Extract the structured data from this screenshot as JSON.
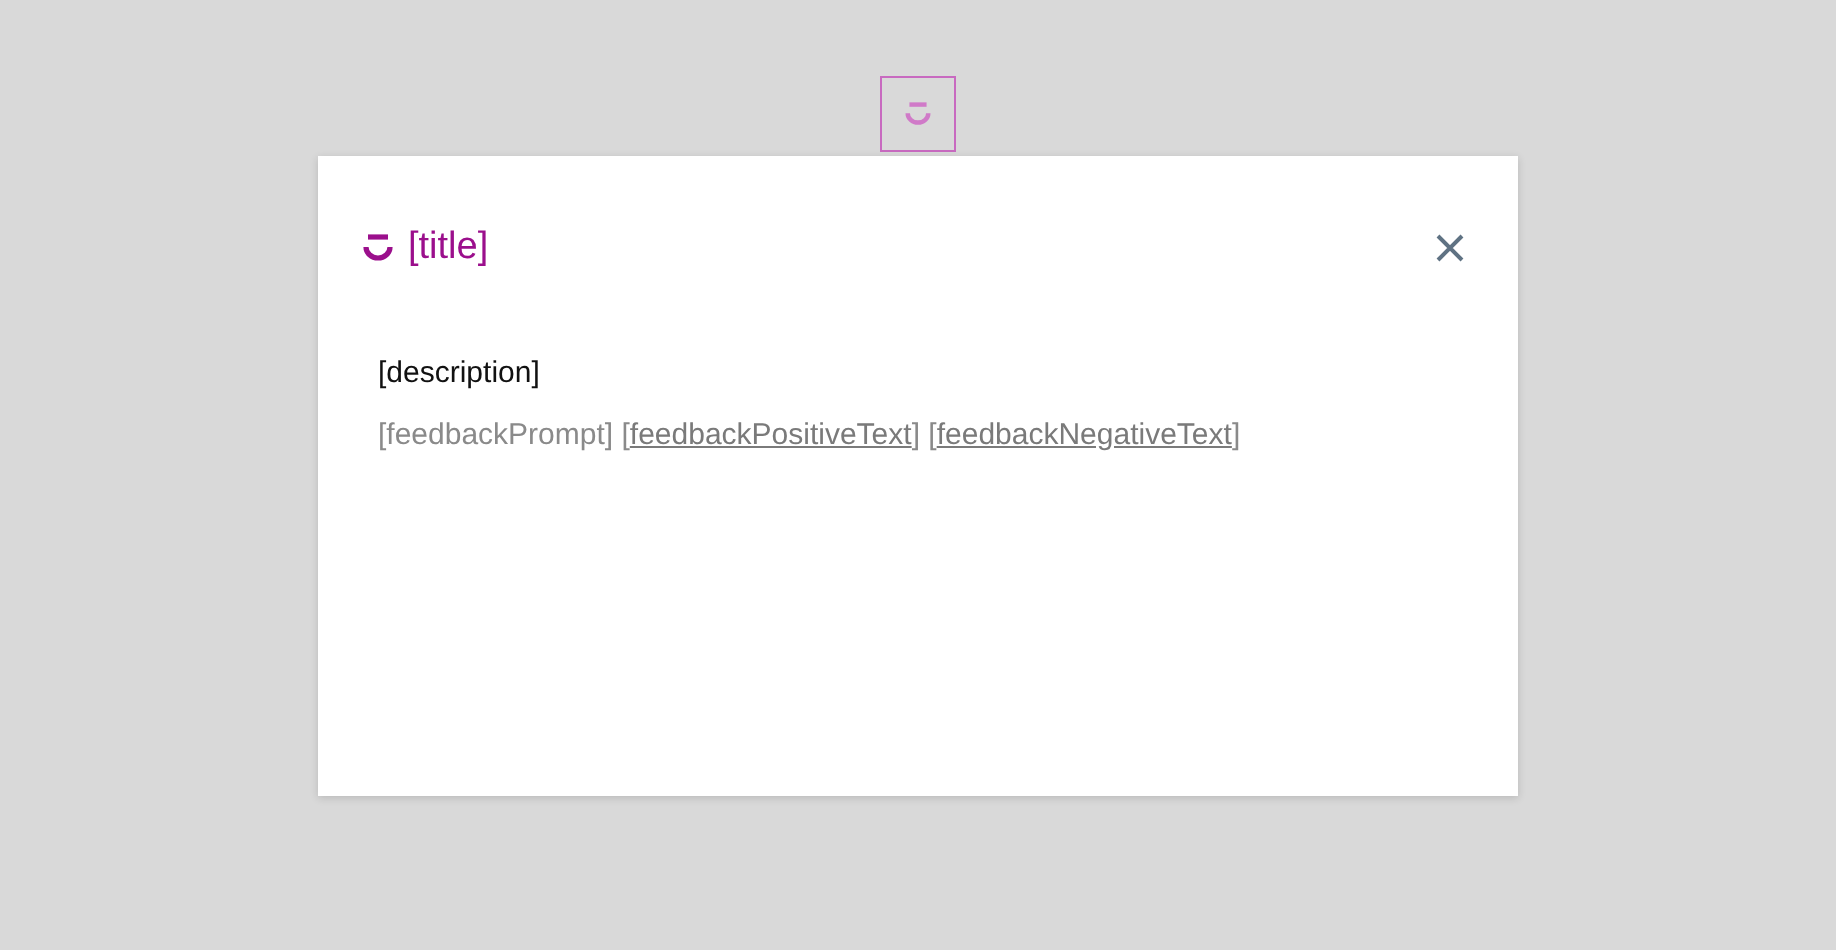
{
  "dialog": {
    "title": "[title]",
    "description": "[description]",
    "feedback": {
      "prompt": "[feedbackPrompt]",
      "links": [
        {
          "open": "[",
          "label": "feedbackPositiveText",
          "close": "]"
        },
        {
          "open": "[",
          "label": "feedbackNegativeText",
          "close": "]"
        }
      ]
    }
  }
}
